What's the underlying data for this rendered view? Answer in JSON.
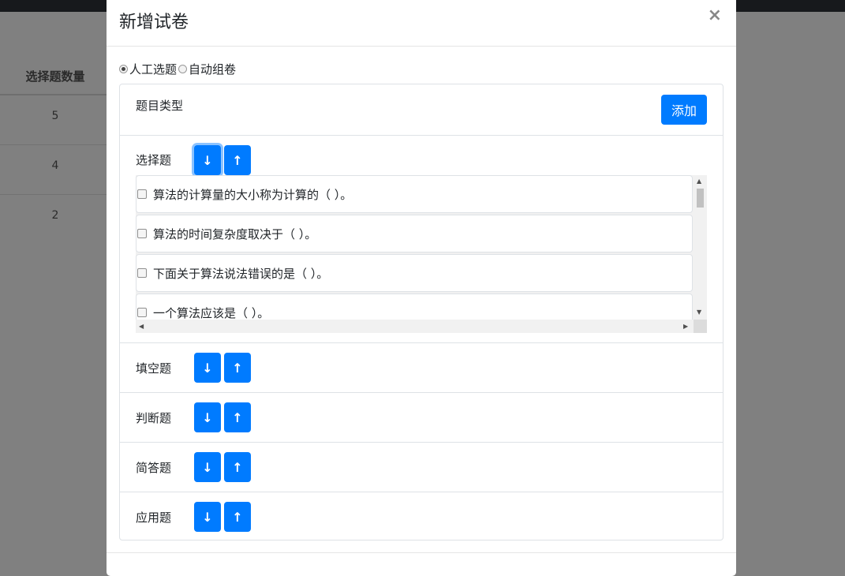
{
  "background": {
    "table_header": "选择题数量",
    "rows": [
      "5",
      "4",
      "2"
    ]
  },
  "modal": {
    "title": "新增试卷",
    "close_symbol": "×",
    "mode_options": [
      "人工选题",
      "自动组卷"
    ],
    "selected_mode": "人工选题",
    "card_header": "题目类型",
    "add_button": "添加",
    "sections": [
      {
        "label": "选择题",
        "expanded": true
      },
      {
        "label": "填空题",
        "expanded": false
      },
      {
        "label": "判断题",
        "expanded": false
      },
      {
        "label": "简答题",
        "expanded": false
      },
      {
        "label": "应用题",
        "expanded": false
      }
    ],
    "down_symbol": "↓",
    "up_symbol": "↑",
    "questions": [
      "算法的计算量的大小称为计算的（ ）。",
      "算法的时间复杂度取决于（ ）。",
      "下面关于算法说法错误的是（ ）。",
      "一个算法应该是（ ）。"
    ]
  },
  "colors": {
    "primary": "#007bff",
    "overlay": "#808080",
    "border": "#dee2e6"
  }
}
